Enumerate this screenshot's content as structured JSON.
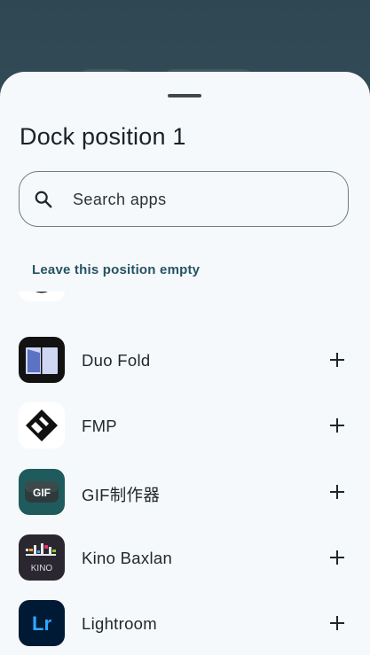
{
  "sheet": {
    "title": "Dock position 1",
    "leave_empty_label": "Leave this position empty"
  },
  "search": {
    "placeholder": "Search apps",
    "value": ""
  },
  "apps": [
    {
      "label": "Duo Fold",
      "icon": "duo-fold-icon"
    },
    {
      "label": "FMP",
      "icon": "fmp-icon"
    },
    {
      "label": "GIF制作器",
      "icon": "gif-maker-icon",
      "icon_text": "GIF"
    },
    {
      "label": "Kino Baxlan",
      "icon": "kino-icon",
      "icon_text": "KINO"
    },
    {
      "label": "Lightroom",
      "icon": "lightroom-icon",
      "icon_text": "Lr"
    }
  ],
  "colors": {
    "sheet_bg": "#f6f9fb",
    "accent_text": "#255363",
    "backdrop": "#3c5561"
  }
}
